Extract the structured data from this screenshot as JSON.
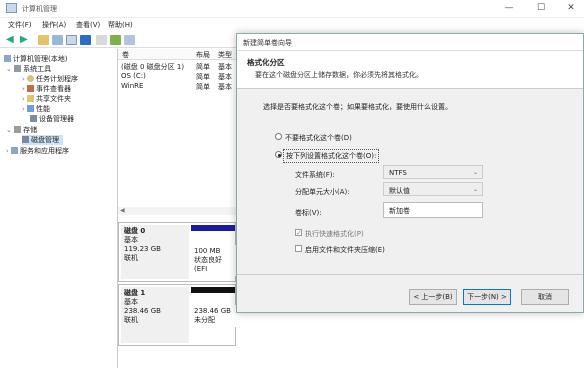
{
  "main_window": {
    "title": "计算机管理",
    "controls": {
      "minimize": "—",
      "maximize": "☐",
      "close": "✕"
    }
  },
  "menu": [
    "文件(F)",
    "操作(A)",
    "查看(V)",
    "帮助(H)"
  ],
  "tree": [
    {
      "label": "计算机管理(本地)",
      "icon": "computer-icon"
    },
    {
      "label": "系统工具",
      "icon": "tools-icon"
    },
    {
      "label": "任务计划程序",
      "icon": "clock-icon"
    },
    {
      "label": "事件查看器",
      "icon": "event-icon"
    },
    {
      "label": "共享文件夹",
      "icon": "folder-icon"
    },
    {
      "label": "性能",
      "icon": "performance-icon"
    },
    {
      "label": "设备管理器",
      "icon": "device-icon"
    },
    {
      "label": "存储",
      "icon": "storage-icon"
    },
    {
      "label": "磁盘管理",
      "icon": "disk-icon"
    },
    {
      "label": "服务和应用程序",
      "icon": "services-icon"
    }
  ],
  "volume_list": {
    "headers": [
      "卷",
      "布局",
      "类型"
    ],
    "rows": [
      [
        "(磁盘 0 磁盘分区 1)",
        "简单",
        "基本"
      ],
      [
        "OS (C:)",
        "简单",
        "基本"
      ],
      [
        "WinRE",
        "简单",
        "基本"
      ]
    ]
  },
  "disks": [
    {
      "name": "磁盘 0",
      "kind": "基本",
      "size": "119.23 GB",
      "status": "联机",
      "partition_size": "100 MB",
      "partition_status": "状态良好 (EFI"
    },
    {
      "name": "磁盘 1",
      "kind": "基本",
      "size": "238.46 GB",
      "status": "联机",
      "partition_size": "238.46 GB",
      "partition_status": "未分配"
    }
  ],
  "wizard": {
    "title": "新建简单卷向导",
    "header": "格式化分区",
    "subheader": "要在这个磁盘分区上储存数据，你必须先将其格式化。",
    "prompt": "选择是否要格式化这个卷；如果要格式化，要使用什么设置。",
    "option_no_format": "不要格式化这个卷(D)",
    "option_format": "按下列设置格式化这个卷(O):",
    "fs_label": "文件系统(F):",
    "fs_value": "NTFS",
    "alloc_label": "分配单元大小(A):",
    "alloc_value": "默认值",
    "volume_label_label": "卷标(V):",
    "volume_label_value": "新加卷",
    "quick_format": "执行快速格式化(P)",
    "compression": "启用文件和文件夹压缩(E)",
    "back_button": "< 上一步(B)",
    "next_button": "下一步(N) >",
    "cancel_button": "取消"
  },
  "colors": {
    "disk_bar": "#1a1aa6",
    "unallocated_bar": "#111111",
    "default_button_border": "#0078d7"
  }
}
